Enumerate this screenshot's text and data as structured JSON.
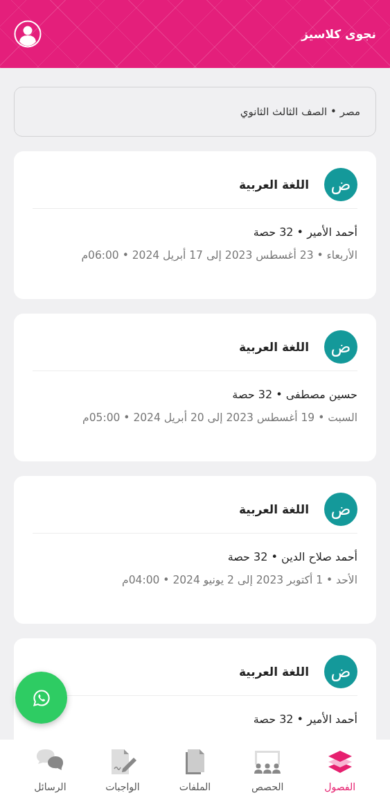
{
  "header": {
    "title": "نجوى كلاسيز"
  },
  "info": {
    "text": "مصر • الصف الثالث الثانوي"
  },
  "courses": [
    {
      "icon_letter": "ض",
      "subject": "اللغة العربية",
      "teacher": "أحمد الأمير • 32 حصة",
      "schedule": "الأربعاء • 23 أغسطس 2023 إلى 17 أبريل 2024 • 06:00م"
    },
    {
      "icon_letter": "ض",
      "subject": "اللغة العربية",
      "teacher": "حسين مصطفى • 32 حصة",
      "schedule": "السبت • 19 أغسطس 2023 إلى 20 أبريل 2024 • 05:00م"
    },
    {
      "icon_letter": "ض",
      "subject": "اللغة العربية",
      "teacher": "أحمد صلاح الدين • 32 حصة",
      "schedule": "الأحد • 1 أكتوبر 2023 إلى 2 يونيو 2024 • 04:00م"
    },
    {
      "icon_letter": "ض",
      "subject": "اللغة العربية",
      "teacher": "أحمد الأمير • 32 حصة"
    }
  ],
  "nav": [
    {
      "kind": "classes",
      "label": "الفصول",
      "selected": true
    },
    {
      "kind": "sessions",
      "label": "الحصص",
      "selected": false
    },
    {
      "kind": "files",
      "label": "الملفات",
      "selected": false
    },
    {
      "kind": "homework",
      "label": "الواجبات",
      "selected": false
    },
    {
      "kind": "messages",
      "label": "الرسائل",
      "selected": false
    }
  ]
}
